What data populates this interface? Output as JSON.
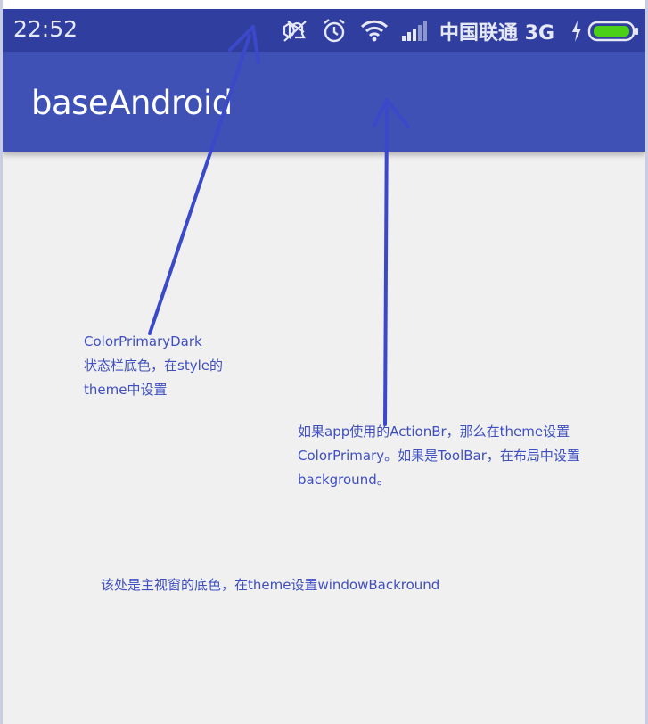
{
  "status_bar": {
    "time": "22:52",
    "carrier": "中国联通 3G",
    "icons": [
      "mute-icon",
      "alarm-icon",
      "wifi-icon",
      "signal-icon",
      "charging-icon",
      "battery-icon"
    ],
    "color": "#303f9f"
  },
  "toolbar": {
    "title": "baseAndroid",
    "color": "#3f51b5"
  },
  "window": {
    "background_color": "#f0f0f0"
  },
  "annotations": {
    "status_bar_note": {
      "line1": "ColorPrimaryDark",
      "line2": "状态栏底色，在style的",
      "line3": "theme中设置"
    },
    "toolbar_note": {
      "line1": "如果app使用的ActionBr，那么在theme设置",
      "line2": "ColorPrimary。如果是ToolBar，在布局中设置",
      "line3": "background。"
    },
    "window_note": {
      "line1": "该处是主视窗的底色，在theme设置windowBackround"
    },
    "arrow_color": "#3a49c9"
  }
}
